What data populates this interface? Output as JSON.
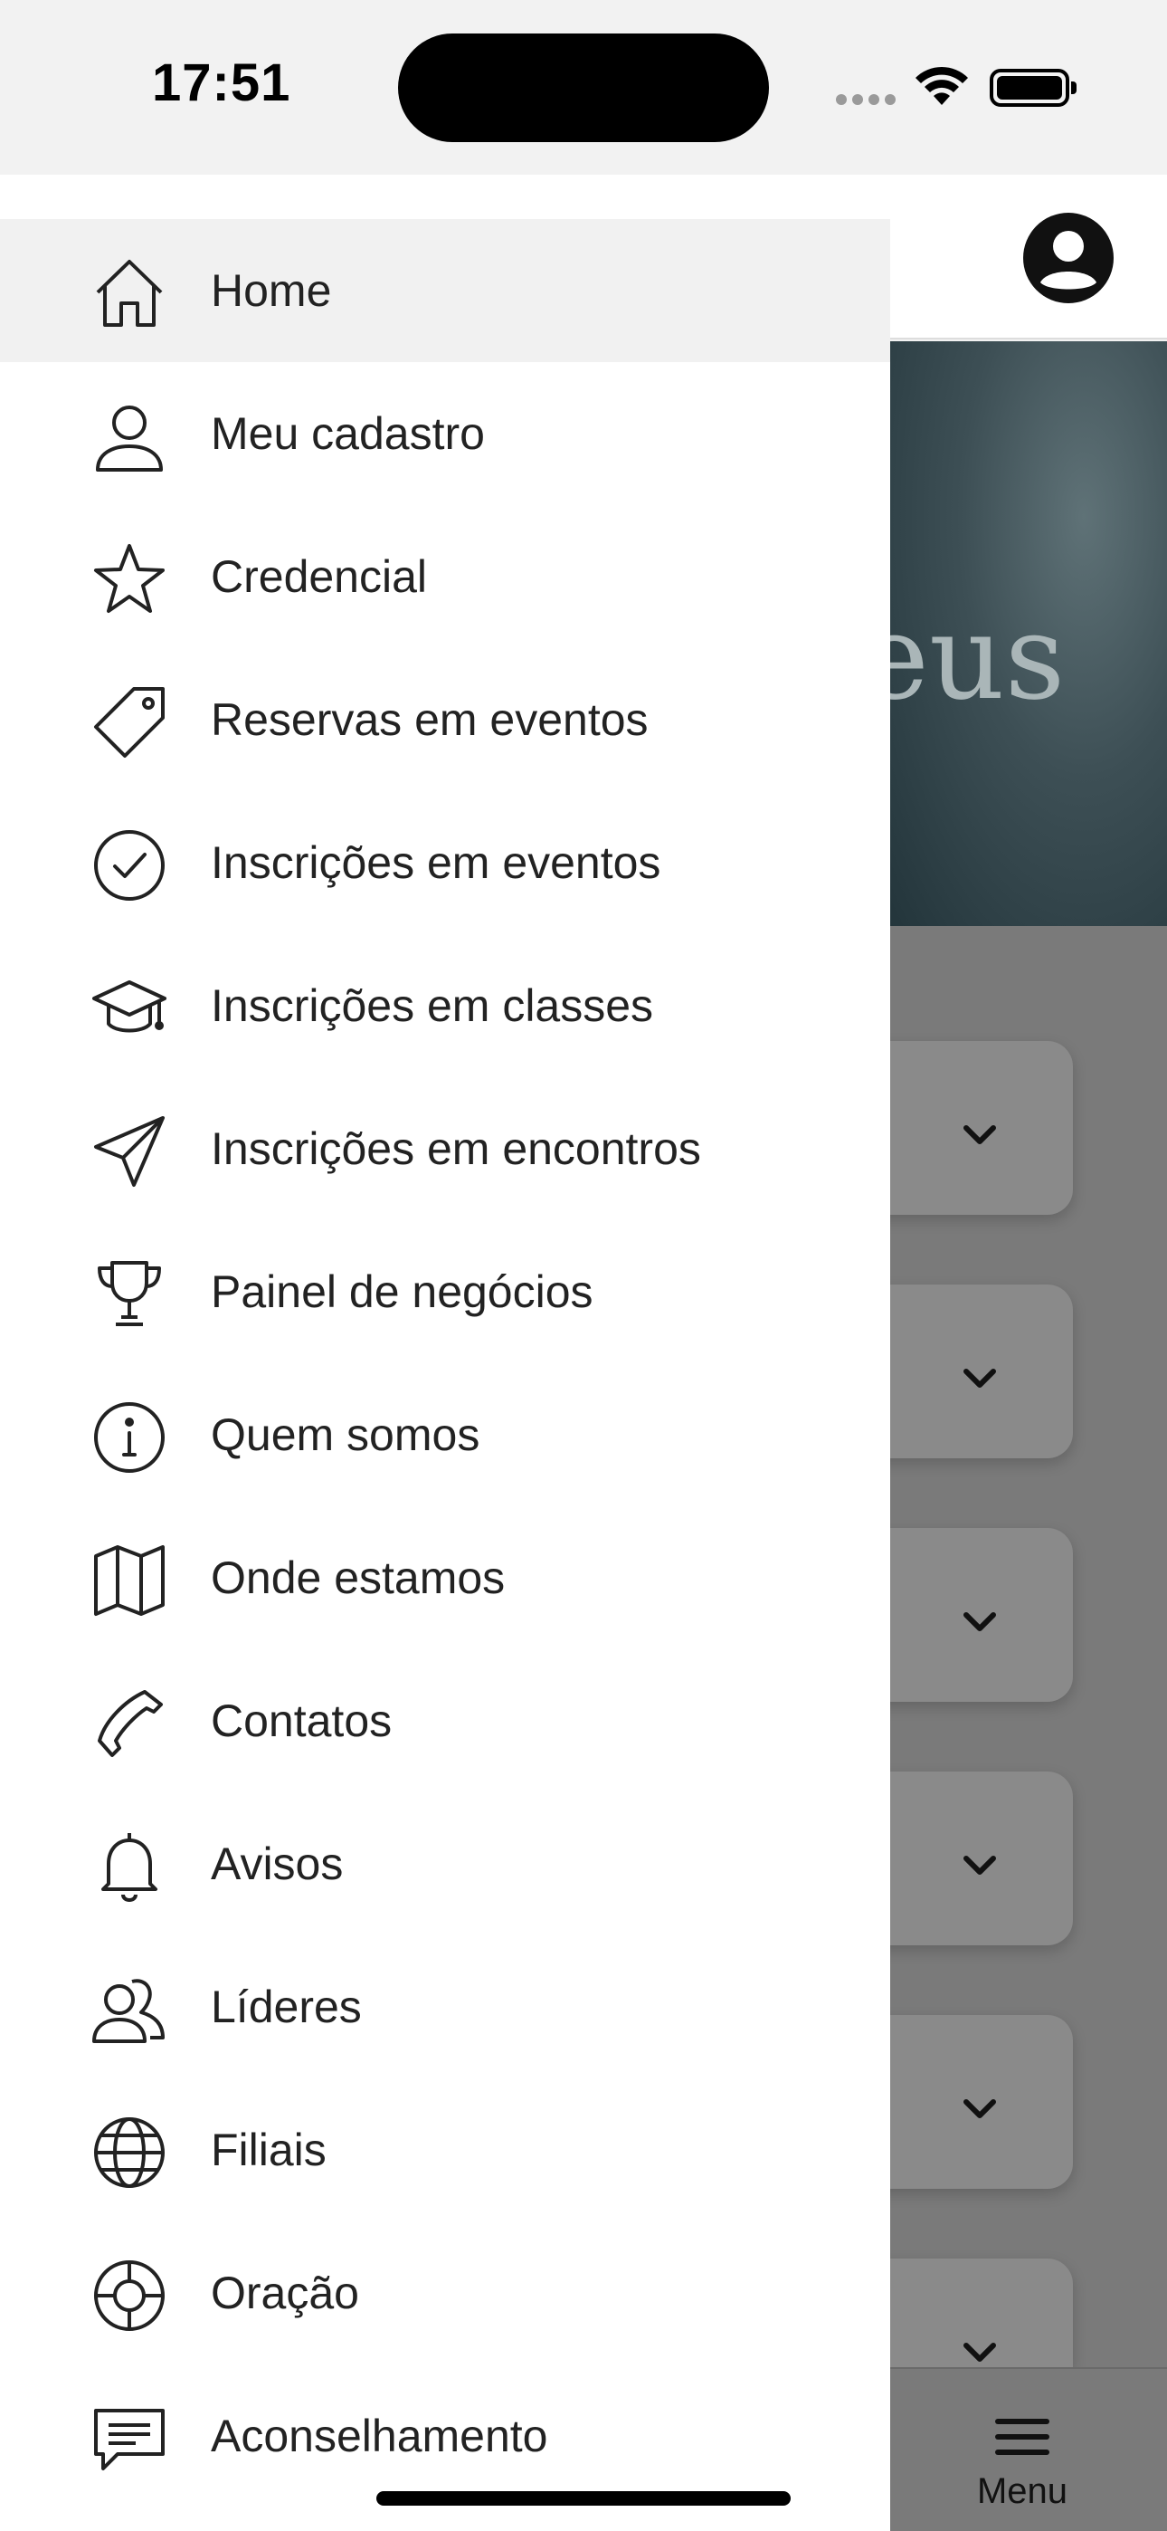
{
  "status_bar": {
    "time": "17:51"
  },
  "drawer": {
    "items": [
      {
        "label": "Home",
        "icon": "home-icon",
        "active": true
      },
      {
        "label": "Meu cadastro",
        "icon": "user-icon"
      },
      {
        "label": "Credencial",
        "icon": "star-icon"
      },
      {
        "label": "Reservas em eventos",
        "icon": "tag-icon"
      },
      {
        "label": "Inscrições em eventos",
        "icon": "check-circle-icon"
      },
      {
        "label": "Inscrições em classes",
        "icon": "graduation-cap-icon"
      },
      {
        "label": "Inscrições em encontros",
        "icon": "send-icon"
      },
      {
        "label": "Painel de negócios",
        "icon": "trophy-icon"
      },
      {
        "label": "Quem somos",
        "icon": "info-icon"
      },
      {
        "label": "Onde estamos",
        "icon": "map-icon"
      },
      {
        "label": "Contatos",
        "icon": "phone-icon"
      },
      {
        "label": "Avisos",
        "icon": "bell-icon"
      },
      {
        "label": "Líderes",
        "icon": "users-icon"
      },
      {
        "label": "Filiais",
        "icon": "globe-icon"
      },
      {
        "label": "Oração",
        "icon": "lifebuoy-icon"
      },
      {
        "label": "Aconselhamento",
        "icon": "message-icon"
      }
    ]
  },
  "background": {
    "hero_text": "eus",
    "bottom_nav": {
      "menu_label": "Menu"
    }
  },
  "colors": {
    "drawer_bg": "#ffffff",
    "active_item_bg": "#f1f1f1",
    "overlay": "#7a7a7a"
  }
}
